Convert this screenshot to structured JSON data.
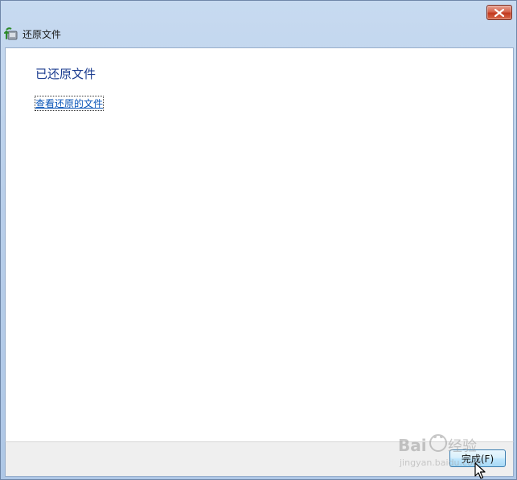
{
  "window": {
    "title": "还原文件",
    "close_icon": "close-icon"
  },
  "content": {
    "heading": "已还原文件",
    "view_link": "查看还原的文件"
  },
  "footer": {
    "finish_label": "完成(F)"
  },
  "watermark": {
    "text": "Bai du 经验",
    "subtext": "jingyan.baidu.com"
  },
  "colors": {
    "heading": "#1a3b8f",
    "link": "#0a55b8",
    "close_button": "#c2391f"
  }
}
